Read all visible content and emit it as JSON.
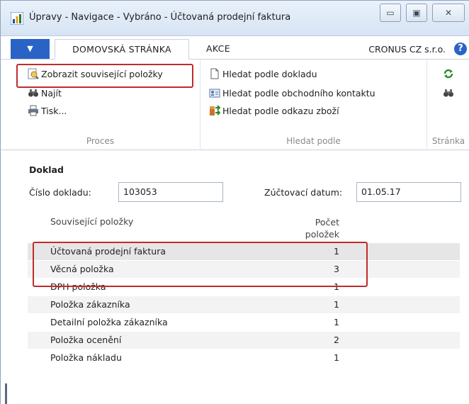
{
  "window": {
    "title": "Úpravy - Navigace - Vybráno - Účtovaná prodejní faktura",
    "minimize_glyph": "▭",
    "maximize_glyph": "▣",
    "close_glyph": "✕"
  },
  "tabs": {
    "file_glyph": "▼",
    "home": "DOMOVSKÁ STRÁNKA",
    "actions": "AKCE",
    "company": "CRONUS CZ s.r.o.",
    "help_glyph": "?"
  },
  "ribbon": {
    "proces": {
      "label": "Proces",
      "buttons": [
        {
          "label": "Zobrazit související položky",
          "icon": "magnifier-doc-icon"
        },
        {
          "label": "Najít",
          "icon": "binoculars-icon"
        },
        {
          "label": "Tisk...",
          "icon": "printer-icon"
        }
      ]
    },
    "hledat": {
      "label": "Hledat podle",
      "buttons": [
        {
          "label": "Hledat podle dokladu",
          "icon": "document-icon"
        },
        {
          "label": "Hledat podle obchodního kontaktu",
          "icon": "contact-card-icon"
        },
        {
          "label": "Hledat podle odkazu zboží",
          "icon": "item-reference-icon"
        }
      ]
    },
    "stranka": {
      "label": "Stránka",
      "buttons": [
        {
          "icon": "refresh-icon"
        },
        {
          "icon": "binoculars-icon"
        }
      ]
    }
  },
  "document": {
    "section_title": "Doklad",
    "doc_no_label": "Číslo dokladu:",
    "doc_no_value": "103053",
    "posting_date_label": "Zúčtovací datum:",
    "posting_date_value": "01.05.17"
  },
  "grid": {
    "col_name": "Související položky",
    "col_count_line1": "Počet",
    "col_count_line2": "položek",
    "rows": [
      {
        "name": "Účtovaná prodejní faktura",
        "count": "1"
      },
      {
        "name": "Věcná položka",
        "count": "3"
      },
      {
        "name": "DPH položka",
        "count": "1"
      },
      {
        "name": "Položka zákazníka",
        "count": "1"
      },
      {
        "name": "Detailní položka zákazníka",
        "count": "1"
      },
      {
        "name": "Položka ocenění",
        "count": "2"
      },
      {
        "name": "Položka nákladu",
        "count": "1"
      }
    ]
  },
  "colors": {
    "accent": "#2a63c6",
    "highlight_border": "#c12b2b",
    "selected_row": "#e6e6e6"
  }
}
